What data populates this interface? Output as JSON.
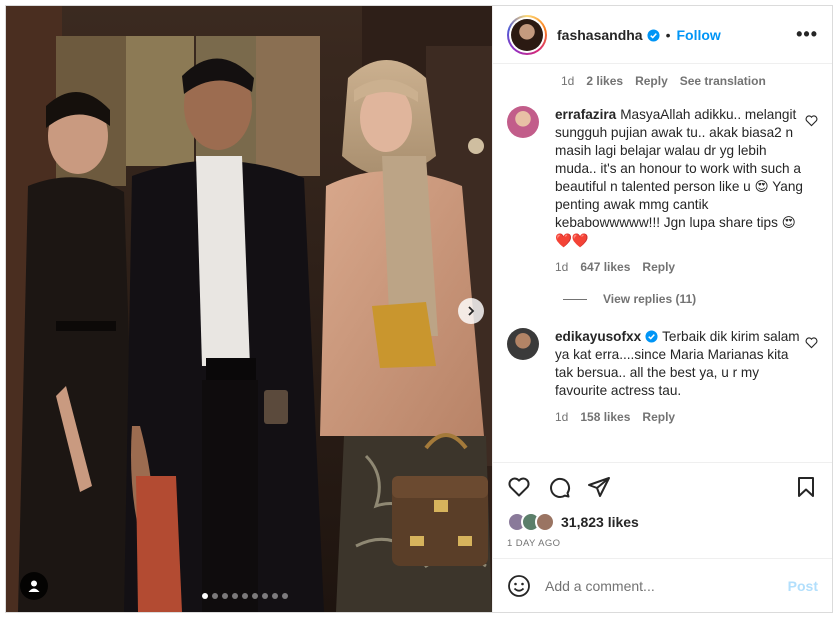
{
  "post": {
    "author": "fashasandha",
    "follow_label": "Follow",
    "separator": "•",
    "more_label": "•••"
  },
  "caption_meta": {
    "age": "1d",
    "likes": "2 likes",
    "reply": "Reply",
    "translate": "See translation"
  },
  "comments": [
    {
      "user": "errafazira",
      "text": "MasyaAllah adikku.. melangit sungguh pujian awak tu.. akak biasa2 n masih lagi belajar walau dr yg lebih muda.. it's an honour to work with such a beautiful n talented person like u 😍 Yang penting awak mmg cantik kebabowwwww!!! Jgn lupa share tips 😍❤️❤️",
      "age": "1d",
      "likes": "647 likes",
      "reply": "Reply",
      "view_replies": "View replies (11)"
    },
    {
      "user": "edikayusofxx",
      "text": "Terbaik dik kirim salam ya kat erra....since Maria Marianas kita tak bersua.. all the best ya, u r my favourite actress tau.",
      "age": "1d",
      "likes": "158 likes",
      "reply": "Reply"
    }
  ],
  "likes_count": "31,823 likes",
  "post_date": "1 DAY AGO",
  "comment_box": {
    "placeholder": "Add a comment...",
    "post_label": "Post"
  },
  "carousel": {
    "slides": 9,
    "active_index": 0
  },
  "colors": {
    "accent": "#0095f6",
    "text": "#262626",
    "muted": "#737373",
    "border": "#dbdbdb",
    "post_disabled": "#b2dffc"
  }
}
